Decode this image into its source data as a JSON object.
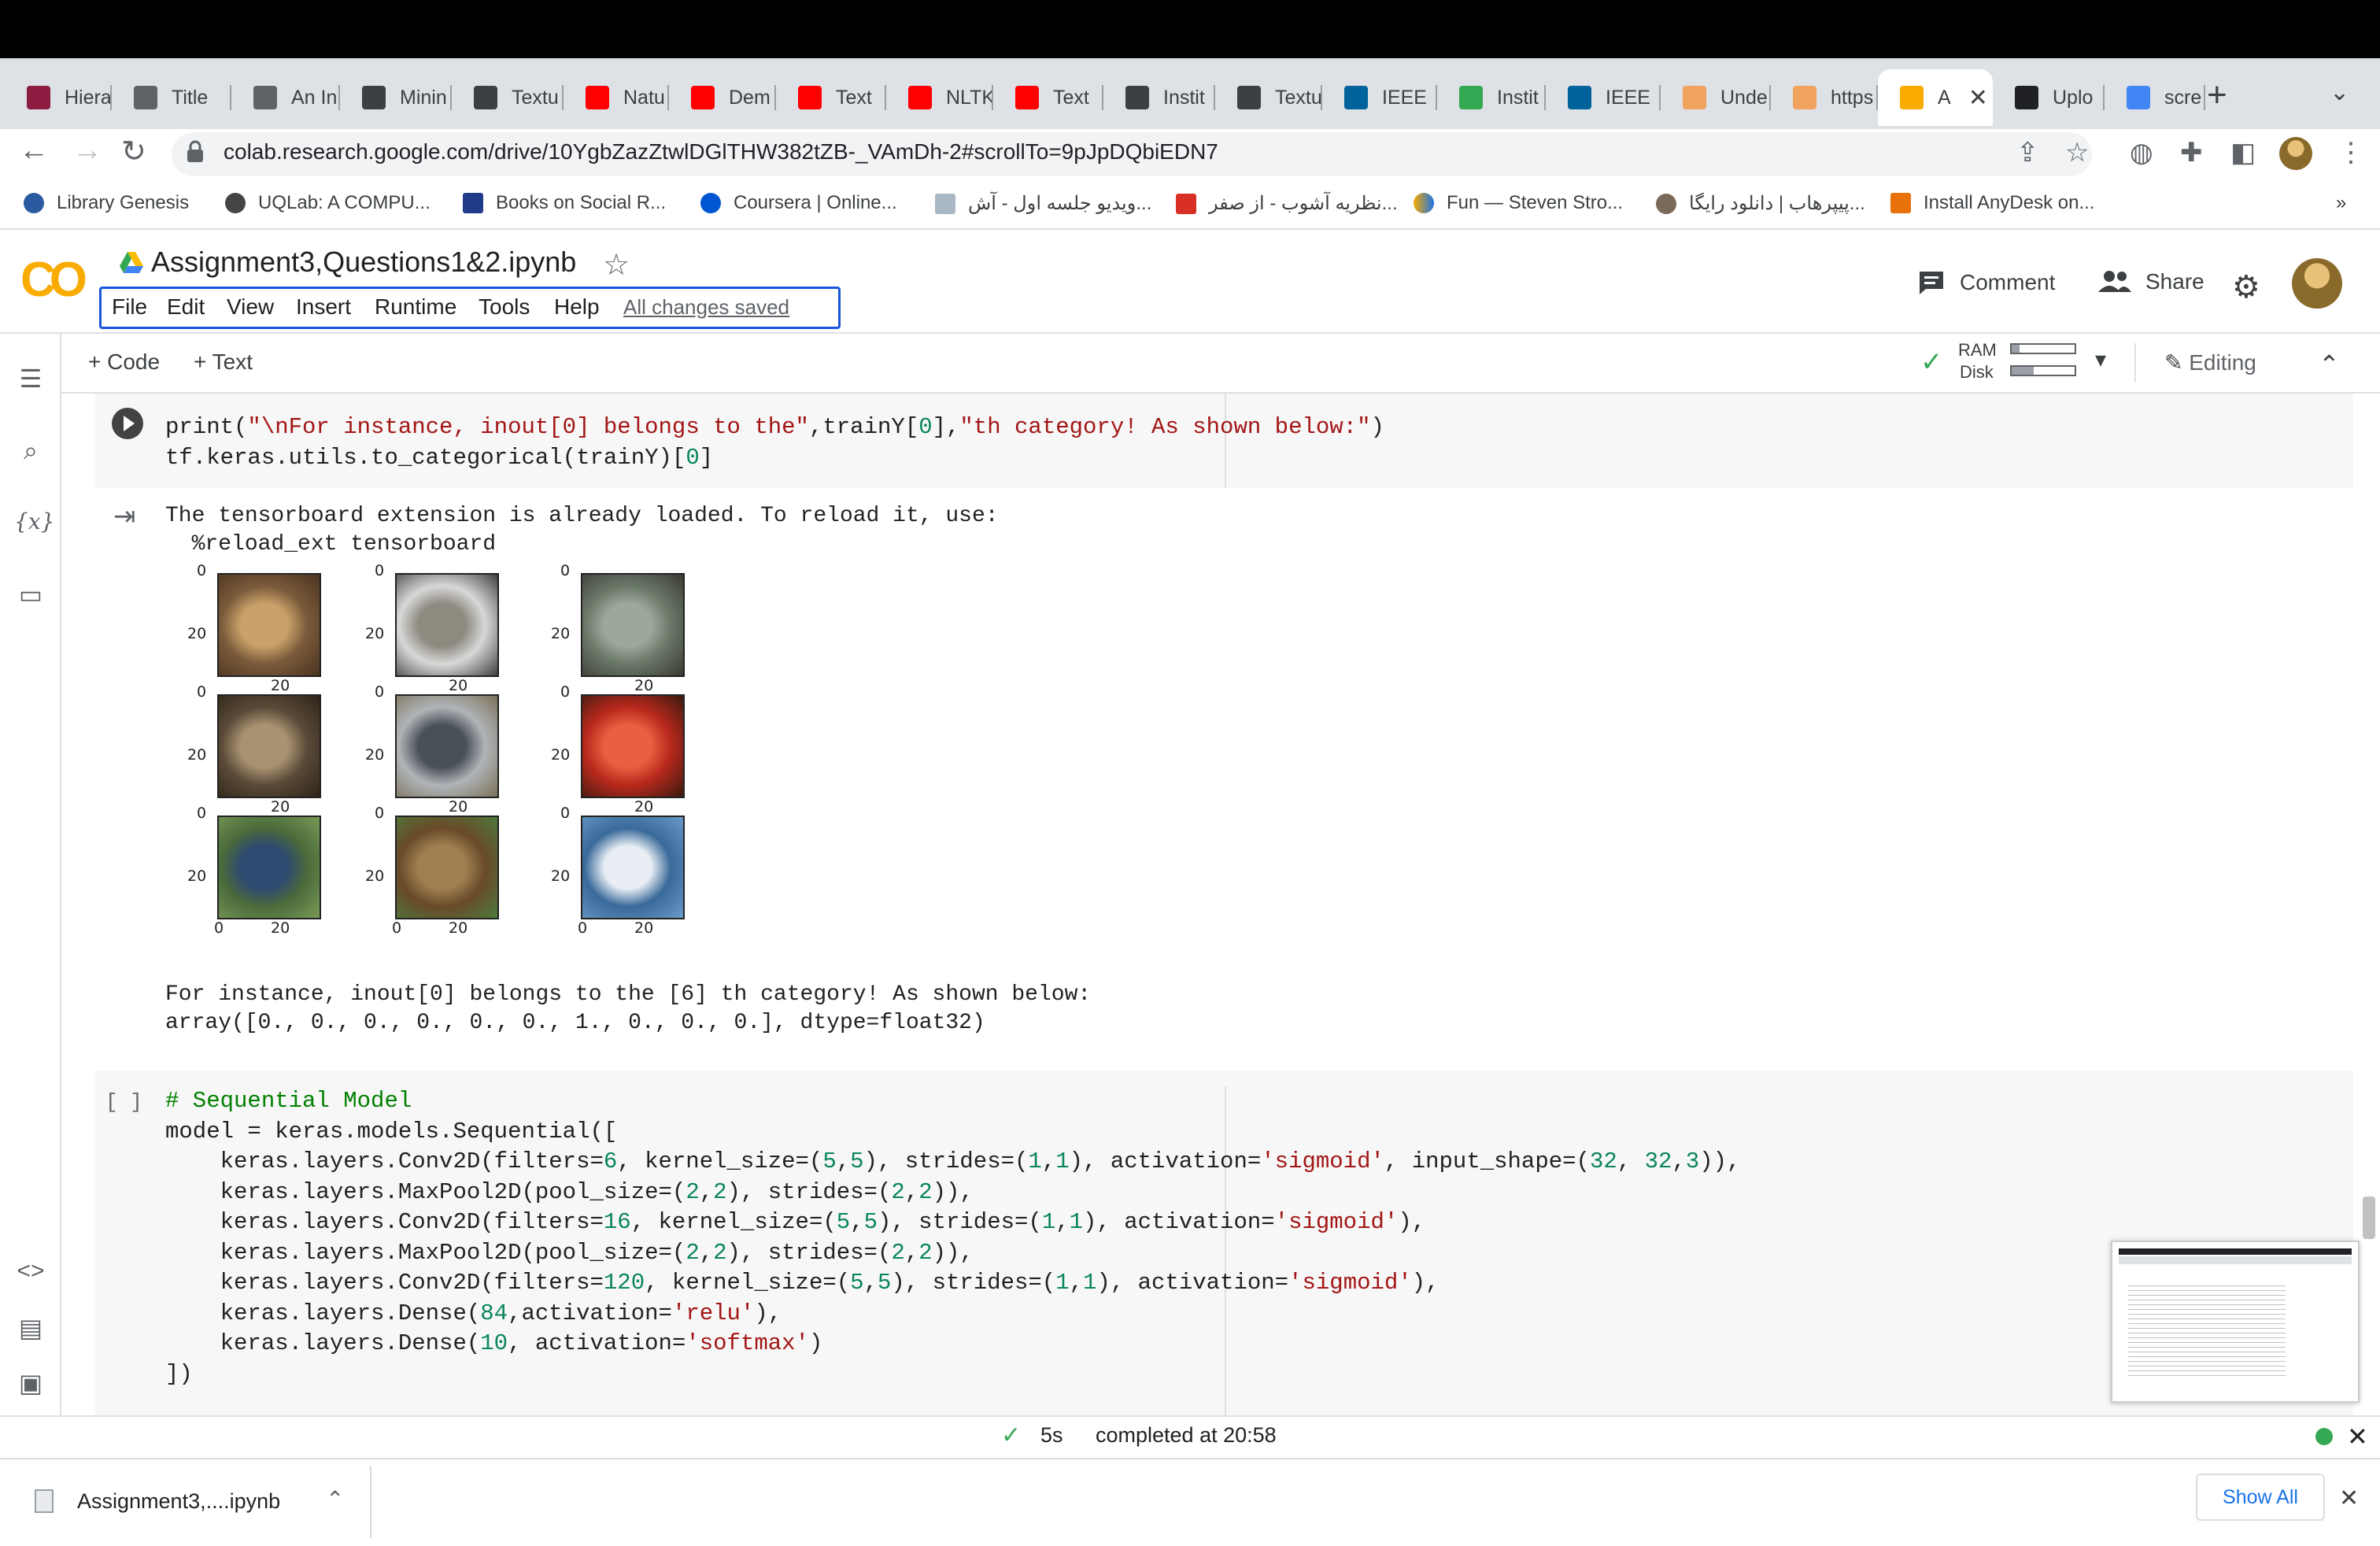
{
  "browser": {
    "tabs": [
      {
        "label": "Hiera",
        "icon": "asu-icon",
        "color": "#8c1d40"
      },
      {
        "label": "Title",
        "icon": "globe-icon",
        "color": "#5f6368"
      },
      {
        "label": "An In",
        "icon": "globe-icon",
        "color": "#5f6368"
      },
      {
        "label": "Minin",
        "icon": "arc-icon",
        "color": "#3c4043"
      },
      {
        "label": "Textu",
        "icon": "arc-icon",
        "color": "#3c4043"
      },
      {
        "label": "Natu",
        "icon": "youtube-icon",
        "color": "#ff0000"
      },
      {
        "label": "Dem",
        "icon": "youtube-icon",
        "color": "#ff0000"
      },
      {
        "label": "Text",
        "icon": "youtube-icon",
        "color": "#ff0000"
      },
      {
        "label": "NLTK",
        "icon": "youtube-icon",
        "color": "#ff0000"
      },
      {
        "label": "Text",
        "icon": "youtube-icon",
        "color": "#ff0000"
      },
      {
        "label": "Instit",
        "icon": "arc-icon",
        "color": "#3c4043"
      },
      {
        "label": "Textu",
        "icon": "arc-icon",
        "color": "#3c4043"
      },
      {
        "label": "IEEE",
        "icon": "ieee-icon",
        "color": "#00629b"
      },
      {
        "label": "Instit",
        "icon": "chrome-icon",
        "color": "#34a853"
      },
      {
        "label": "IEEE",
        "icon": "ieee-icon",
        "color": "#00629b"
      },
      {
        "label": "Unde",
        "icon": "e-icon",
        "color": "#f0a35e"
      },
      {
        "label": "https",
        "icon": "e-icon",
        "color": "#f0a35e"
      },
      {
        "label": "A",
        "icon": "colab-icon",
        "color": "#f9ab00",
        "active": true
      },
      {
        "label": "Uplo",
        "icon": "github-icon",
        "color": "#202124"
      },
      {
        "label": "scre",
        "icon": "google-icon",
        "color": "#4285f4"
      }
    ],
    "url": "colab.research.google.com/drive/10YgbZazZtwlDGlTHW382tZB-_VAmDh-2#scrollTo=9pJpDQbiEDN7",
    "bookmarks": [
      "Library Genesis",
      "UQLab: A COMPU...",
      "Books on Social R...",
      "Coursera | Online...",
      "ویدیو جلسه اول - آش...",
      "نظریه آشوب - از صفر...",
      "Fun — Steven Stro...",
      "پیپرهاب | دانلود رایگا...",
      "Install AnyDesk on..."
    ],
    "bookmarks_more": "»"
  },
  "colab": {
    "title": "Assignment3,Questions1&2.ipynb",
    "menu": [
      "File",
      "Edit",
      "View",
      "Insert",
      "Runtime",
      "Tools",
      "Help"
    ],
    "saved_status": "All changes saved",
    "comment_label": "Comment",
    "share_label": "Share",
    "add_code": "+ Code",
    "add_text": "+ Text",
    "ram_label": "RAM",
    "disk_label": "Disk",
    "ram_usage": 0.12,
    "disk_usage": 0.35,
    "editing_label": "Editing",
    "brand_color": "#f9ab00"
  },
  "cell1": {
    "code_line1_a": "print(",
    "code_line1_s1": "\"\\nFor instance, inout[0] belongs to the\"",
    "code_line1_b": ",trainY[",
    "code_line1_n": "0",
    "code_line1_c": "],",
    "code_line1_s2": "\"th category! As shown below:\"",
    "code_line1_d": ")",
    "code_line2_a": "tf.keras.utils.to_categorical(trainY)[",
    "code_line2_n": "0",
    "code_line2_b": "]"
  },
  "output1": {
    "line1": "The tensorboard extension is already loaded. To reload it, use:",
    "line2": "  %reload_ext tensorboard",
    "tick0": "0",
    "tick20": "20",
    "line3": "For instance, inout[0] belongs to the [6] th category! As shown below:",
    "line4": "array([0., 0., 0., 0., 0., 0., 1., 0., 0., 0.], dtype=float32)"
  },
  "cell2": {
    "bracket": "[ ]",
    "comment": "# Sequential Model",
    "l2": "model = keras.models.Sequential([",
    "l3a": "    keras.layers.Conv2D(filters=",
    "l3n1": "6",
    "l3b": ", kernel_size=(",
    "l3n2": "5",
    "l3c": ",",
    "l3n3": "5",
    "l3d": "), strides=(",
    "l3n4": "1",
    "l3e": ",",
    "l3n5": "1",
    "l3f": "), activation=",
    "l3s": "'sigmoid'",
    "l3g": ", input_shape=(",
    "l3n6": "32",
    "l3h": ", ",
    "l3n7": "32",
    "l3i": ",",
    "l3n8": "3",
    "l3j": ")),",
    "l4a": "    keras.layers.MaxPool2D(pool_size=(",
    "l4n1": "2",
    "l4b": ",",
    "l4n2": "2",
    "l4c": "), strides=(",
    "l4n3": "2",
    "l4d": ",",
    "l4n4": "2",
    "l4e": ")),",
    "l5a": "    keras.layers.Conv2D(filters=",
    "l5n1": "16",
    "l5b": ", kernel_size=(",
    "l5n2": "5",
    "l5c": ",",
    "l5n3": "5",
    "l5d": "), strides=(",
    "l5n4": "1",
    "l5e": ",",
    "l5n5": "1",
    "l5f": "), activation=",
    "l5s": "'sigmoid'",
    "l5g": "),",
    "l6a": "    keras.layers.MaxPool2D(pool_size=(",
    "l6n1": "2",
    "l6b": ",",
    "l6n2": "2",
    "l6c": "), strides=(",
    "l6n3": "2",
    "l6d": ",",
    "l6n4": "2",
    "l6e": ")),",
    "l7a": "    keras.layers.Conv2D(filters=",
    "l7n1": "120",
    "l7b": ", kernel_size=(",
    "l7n2": "5",
    "l7c": ",",
    "l7n3": "5",
    "l7d": "), strides=(",
    "l7n4": "1",
    "l7e": ",",
    "l7n5": "1",
    "l7f": "), activation=",
    "l7s": "'sigmoid'",
    "l7g": "),",
    "l8a": "    keras.layers.Dense(",
    "l8n": "84",
    "l8b": ",activation=",
    "l8s": "'relu'",
    "l8c": "),",
    "l9a": "    keras.layers.Dense(",
    "l9n": "10",
    "l9b": ", activation=",
    "l9s": "'softmax'",
    "l9c": ")",
    "l10": "])"
  },
  "status": {
    "duration": "5s",
    "completed": "completed at 20:58"
  },
  "download": {
    "filename": "Assignment3,....ipynb",
    "show_all": "Show All"
  }
}
